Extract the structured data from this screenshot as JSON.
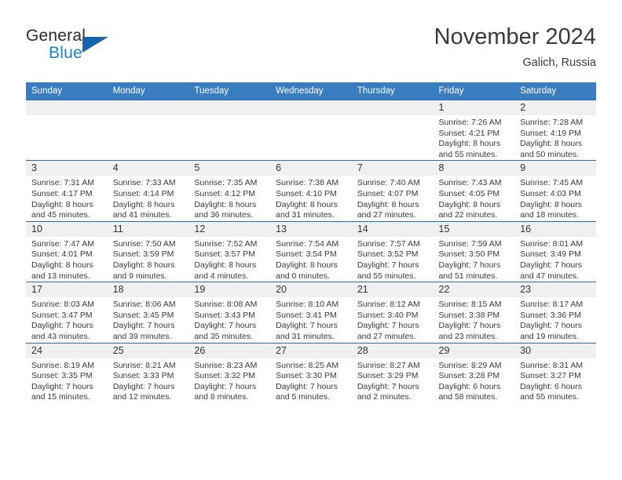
{
  "brand": {
    "name_part1": "General",
    "name_part2": "Blue",
    "accent_color": "#1f7fd0",
    "triangle_color": "#1565ad"
  },
  "header": {
    "month_title": "November 2024",
    "location": "Galich, Russia"
  },
  "calendar": {
    "header_color": "#3a7cc0",
    "weekday_headers": [
      "Sunday",
      "Monday",
      "Tuesday",
      "Wednesday",
      "Thursday",
      "Friday",
      "Saturday"
    ],
    "weeks": [
      [
        {
          "day": "",
          "lines": []
        },
        {
          "day": "",
          "lines": []
        },
        {
          "day": "",
          "lines": []
        },
        {
          "day": "",
          "lines": []
        },
        {
          "day": "",
          "lines": []
        },
        {
          "day": "1",
          "lines": [
            "Sunrise: 7:26 AM",
            "Sunset: 4:21 PM",
            "Daylight: 8 hours",
            "and 55 minutes."
          ]
        },
        {
          "day": "2",
          "lines": [
            "Sunrise: 7:28 AM",
            "Sunset: 4:19 PM",
            "Daylight: 8 hours",
            "and 50 minutes."
          ]
        }
      ],
      [
        {
          "day": "3",
          "lines": [
            "Sunrise: 7:31 AM",
            "Sunset: 4:17 PM",
            "Daylight: 8 hours",
            "and 45 minutes."
          ]
        },
        {
          "day": "4",
          "lines": [
            "Sunrise: 7:33 AM",
            "Sunset: 4:14 PM",
            "Daylight: 8 hours",
            "and 41 minutes."
          ]
        },
        {
          "day": "5",
          "lines": [
            "Sunrise: 7:35 AM",
            "Sunset: 4:12 PM",
            "Daylight: 8 hours",
            "and 36 minutes."
          ]
        },
        {
          "day": "6",
          "lines": [
            "Sunrise: 7:38 AM",
            "Sunset: 4:10 PM",
            "Daylight: 8 hours",
            "and 31 minutes."
          ]
        },
        {
          "day": "7",
          "lines": [
            "Sunrise: 7:40 AM",
            "Sunset: 4:07 PM",
            "Daylight: 8 hours",
            "and 27 minutes."
          ]
        },
        {
          "day": "8",
          "lines": [
            "Sunrise: 7:43 AM",
            "Sunset: 4:05 PM",
            "Daylight: 8 hours",
            "and 22 minutes."
          ]
        },
        {
          "day": "9",
          "lines": [
            "Sunrise: 7:45 AM",
            "Sunset: 4:03 PM",
            "Daylight: 8 hours",
            "and 18 minutes."
          ]
        }
      ],
      [
        {
          "day": "10",
          "lines": [
            "Sunrise: 7:47 AM",
            "Sunset: 4:01 PM",
            "Daylight: 8 hours",
            "and 13 minutes."
          ]
        },
        {
          "day": "11",
          "lines": [
            "Sunrise: 7:50 AM",
            "Sunset: 3:59 PM",
            "Daylight: 8 hours",
            "and 9 minutes."
          ]
        },
        {
          "day": "12",
          "lines": [
            "Sunrise: 7:52 AM",
            "Sunset: 3:57 PM",
            "Daylight: 8 hours",
            "and 4 minutes."
          ]
        },
        {
          "day": "13",
          "lines": [
            "Sunrise: 7:54 AM",
            "Sunset: 3:54 PM",
            "Daylight: 8 hours",
            "and 0 minutes."
          ]
        },
        {
          "day": "14",
          "lines": [
            "Sunrise: 7:57 AM",
            "Sunset: 3:52 PM",
            "Daylight: 7 hours",
            "and 55 minutes."
          ]
        },
        {
          "day": "15",
          "lines": [
            "Sunrise: 7:59 AM",
            "Sunset: 3:50 PM",
            "Daylight: 7 hours",
            "and 51 minutes."
          ]
        },
        {
          "day": "16",
          "lines": [
            "Sunrise: 8:01 AM",
            "Sunset: 3:49 PM",
            "Daylight: 7 hours",
            "and 47 minutes."
          ]
        }
      ],
      [
        {
          "day": "17",
          "lines": [
            "Sunrise: 8:03 AM",
            "Sunset: 3:47 PM",
            "Daylight: 7 hours",
            "and 43 minutes."
          ]
        },
        {
          "day": "18",
          "lines": [
            "Sunrise: 8:06 AM",
            "Sunset: 3:45 PM",
            "Daylight: 7 hours",
            "and 39 minutes."
          ]
        },
        {
          "day": "19",
          "lines": [
            "Sunrise: 8:08 AM",
            "Sunset: 3:43 PM",
            "Daylight: 7 hours",
            "and 35 minutes."
          ]
        },
        {
          "day": "20",
          "lines": [
            "Sunrise: 8:10 AM",
            "Sunset: 3:41 PM",
            "Daylight: 7 hours",
            "and 31 minutes."
          ]
        },
        {
          "day": "21",
          "lines": [
            "Sunrise: 8:12 AM",
            "Sunset: 3:40 PM",
            "Daylight: 7 hours",
            "and 27 minutes."
          ]
        },
        {
          "day": "22",
          "lines": [
            "Sunrise: 8:15 AM",
            "Sunset: 3:38 PM",
            "Daylight: 7 hours",
            "and 23 minutes."
          ]
        },
        {
          "day": "23",
          "lines": [
            "Sunrise: 8:17 AM",
            "Sunset: 3:36 PM",
            "Daylight: 7 hours",
            "and 19 minutes."
          ]
        }
      ],
      [
        {
          "day": "24",
          "lines": [
            "Sunrise: 8:19 AM",
            "Sunset: 3:35 PM",
            "Daylight: 7 hours",
            "and 15 minutes."
          ]
        },
        {
          "day": "25",
          "lines": [
            "Sunrise: 8:21 AM",
            "Sunset: 3:33 PM",
            "Daylight: 7 hours",
            "and 12 minutes."
          ]
        },
        {
          "day": "26",
          "lines": [
            "Sunrise: 8:23 AM",
            "Sunset: 3:32 PM",
            "Daylight: 7 hours",
            "and 8 minutes."
          ]
        },
        {
          "day": "27",
          "lines": [
            "Sunrise: 8:25 AM",
            "Sunset: 3:30 PM",
            "Daylight: 7 hours",
            "and 5 minutes."
          ]
        },
        {
          "day": "28",
          "lines": [
            "Sunrise: 8:27 AM",
            "Sunset: 3:29 PM",
            "Daylight: 7 hours",
            "and 2 minutes."
          ]
        },
        {
          "day": "29",
          "lines": [
            "Sunrise: 8:29 AM",
            "Sunset: 3:28 PM",
            "Daylight: 6 hours",
            "and 58 minutes."
          ]
        },
        {
          "day": "30",
          "lines": [
            "Sunrise: 8:31 AM",
            "Sunset: 3:27 PM",
            "Daylight: 6 hours",
            "and 55 minutes."
          ]
        }
      ]
    ]
  }
}
